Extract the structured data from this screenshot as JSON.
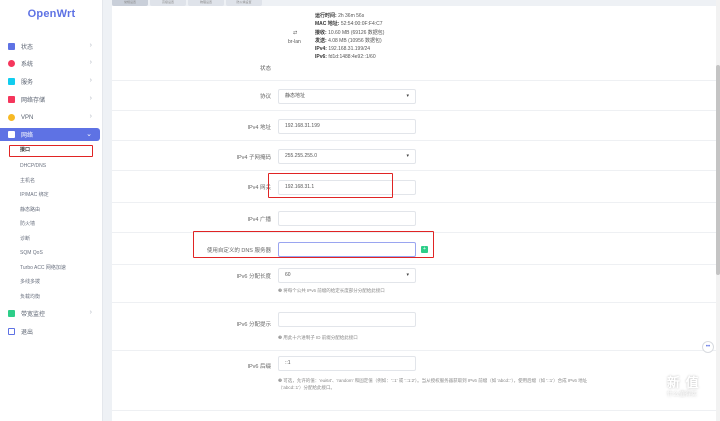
{
  "brand": {
    "logo": "OpenWrt"
  },
  "sidebar": {
    "items": [
      {
        "label": "状态"
      },
      {
        "label": "系统"
      },
      {
        "label": "服务"
      },
      {
        "label": "网络存储"
      },
      {
        "label": "VPN"
      },
      {
        "label": "网络"
      },
      {
        "label": "带宽监控"
      },
      {
        "label": "退出"
      }
    ],
    "network_sub": [
      "接口",
      "DHCP/DNS",
      "主机名",
      "IP/MAC 绑定",
      "静态路由",
      "防火墙",
      "诊断",
      "SQM QoS",
      "Turbo ACC 网络加速",
      "多线多拨",
      "负载均衡"
    ]
  },
  "status": {
    "label": "状态",
    "lines": [
      {
        "k": "运行时间:",
        "v": "2h 36m 56s"
      },
      {
        "k": "MAC 地址:",
        "v": "52:54:00:0F:F4:C7"
      },
      {
        "k": "接收:",
        "v": "10.60 MB (69126 数据包)"
      },
      {
        "k": "发送:",
        "v": "4.08 MB (10956 数据包)"
      },
      {
        "k": "IPv4:",
        "v": "192.168.31.199/24"
      },
      {
        "k": "IPv6:",
        "v": "fd1d:1488:4e92::1/60"
      }
    ],
    "iface": "br-lan"
  },
  "form": {
    "protocol": {
      "label": "协议",
      "value": "静态地址"
    },
    "ipv4_addr": {
      "label": "IPv4 地址",
      "value": "192.168.31.199"
    },
    "netmask": {
      "label": "IPv4 子网掩码",
      "value": "255.255.255.0"
    },
    "gateway": {
      "label": "IPv4 网关",
      "value": "192.168.31.1"
    },
    "broadcast": {
      "label": "IPv4 广播",
      "value": ""
    },
    "dns": {
      "label": "使用自定义的 DNS 服务器",
      "value": ""
    },
    "ipv6_assign": {
      "label": "IPv6 分配长度",
      "value": "60",
      "hint": "❷ 将每个公共 IPv6 前缀的给定长度部分分配给此接口"
    },
    "ipv6_hint": {
      "label": "IPv6 分配提示",
      "value": "",
      "hint": "❷ 用此十六进制子 ID 前缀分配给此接口"
    },
    "ipv6_suffix": {
      "label": "IPv6 后缀",
      "value": "::1",
      "hint1": "❷ 可选，允许的值：'eui64'、'random' 和固定值（例如：'::1' 或 '::1:2'）。当从授权服务器获取到 IPv6 前缀（如 'abcd::'），使用后缀（如 '::1'）合成 IPv6 地址",
      "hint2": "（'abcd::1'）分配给此接口。"
    }
  },
  "tabs": [
    "常规设置",
    "高级设置",
    "物理设置",
    "防火墙设置"
  ],
  "watermark": {
    "line1": "新",
    "line2": "值",
    "line3": "什么值得买"
  },
  "accent": "#5e72e4",
  "highlight": "#e02424"
}
